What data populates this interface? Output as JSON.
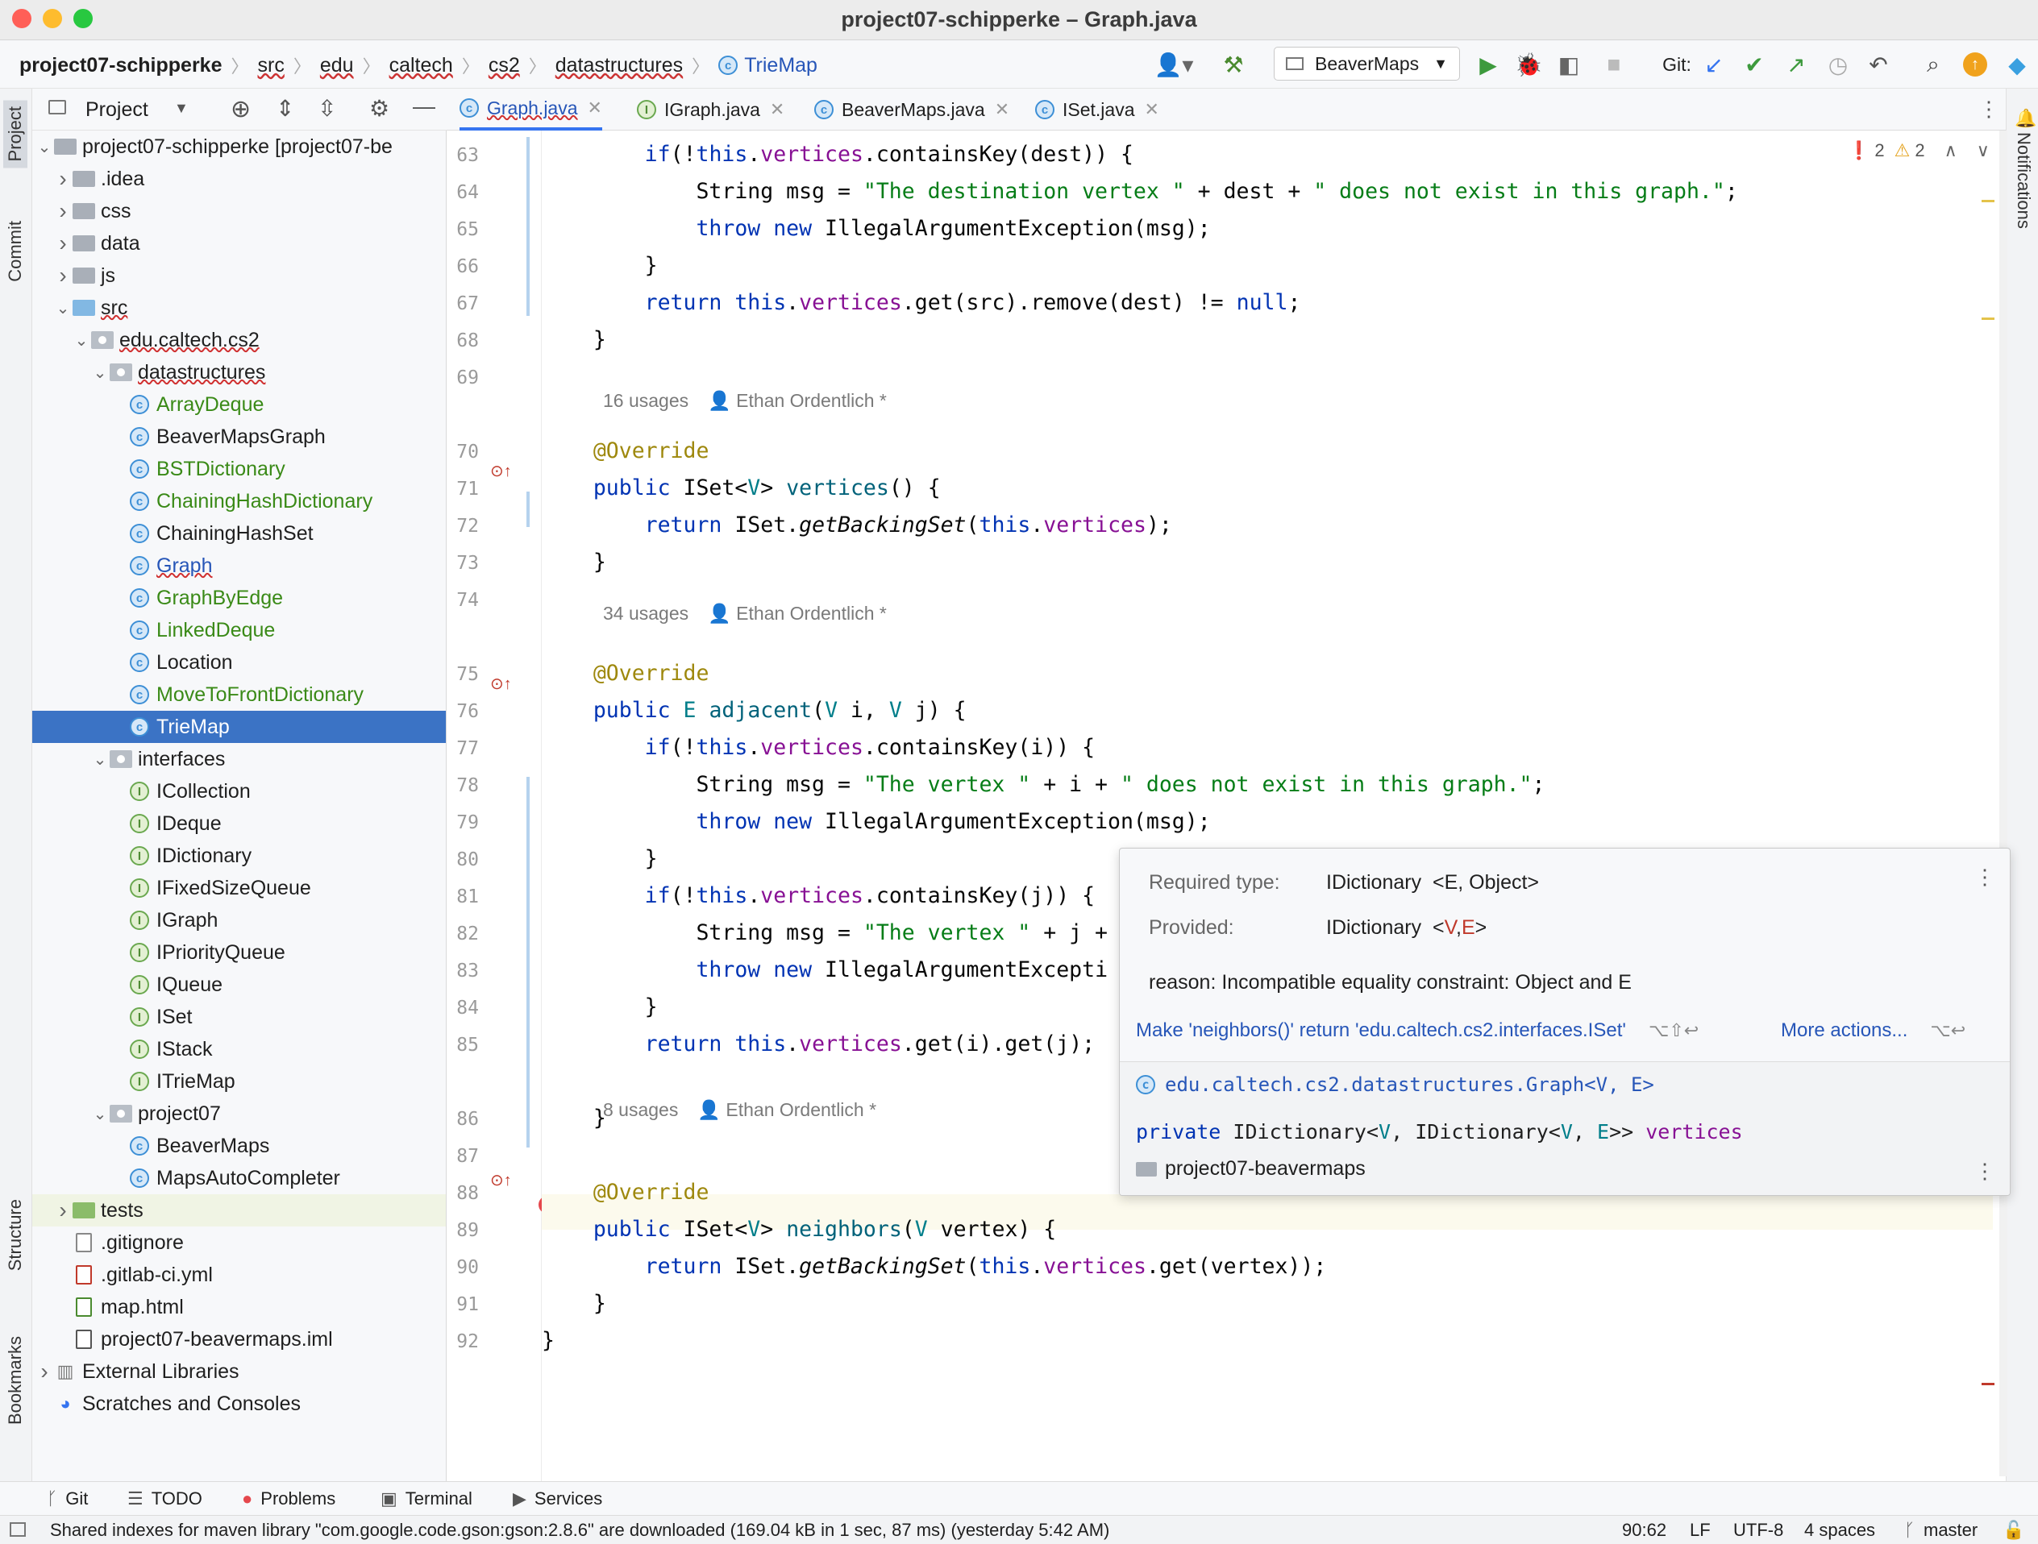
{
  "window": {
    "title": "project07-schipperke – Graph.java"
  },
  "breadcrumbs": [
    "project07-schipperke",
    "src",
    "edu",
    "caltech",
    "cs2",
    "datastructures",
    "TrieMap"
  ],
  "toolbar": {
    "run_config": "BeaverMaps",
    "git_label": "Git:"
  },
  "left_strip": {
    "project": "Project",
    "commit": "Commit",
    "structure": "Structure",
    "bookmarks": "Bookmarks"
  },
  "right_strip": {
    "notifications": "Notifications"
  },
  "project_panel": {
    "title": "Project",
    "tree": [
      {
        "label": "project07-schipperke [project07-be",
        "level": 0,
        "arrow": "open",
        "icon": "module-folder-icon"
      },
      {
        "label": ".idea",
        "level": 1,
        "arrow": "closed",
        "icon": "folder-icon"
      },
      {
        "label": "css",
        "level": 1,
        "arrow": "closed",
        "icon": "folder-icon"
      },
      {
        "label": "data",
        "level": 1,
        "arrow": "closed",
        "icon": "folder-icon"
      },
      {
        "label": "js",
        "level": 1,
        "arrow": "closed",
        "icon": "folder-icon"
      },
      {
        "label": "src",
        "level": 1,
        "arrow": "open",
        "icon": "source-folder-icon"
      },
      {
        "label": "edu.caltech.cs2",
        "level": 2,
        "arrow": "open",
        "icon": "package-icon"
      },
      {
        "label": "datastructures",
        "level": 3,
        "arrow": "open",
        "icon": "package-icon"
      },
      {
        "label": "ArrayDeque",
        "level": 4,
        "icon": "class-icon",
        "color": "green"
      },
      {
        "label": "BeaverMapsGraph",
        "level": 4,
        "icon": "class-icon"
      },
      {
        "label": "BSTDictionary",
        "level": 4,
        "icon": "class-icon",
        "color": "green"
      },
      {
        "label": "ChainingHashDictionary",
        "level": 4,
        "icon": "class-icon",
        "color": "green"
      },
      {
        "label": "ChainingHashSet",
        "level": 4,
        "icon": "class-icon"
      },
      {
        "label": "Graph",
        "level": 4,
        "icon": "class-icon",
        "color": "blue"
      },
      {
        "label": "GraphByEdge",
        "level": 4,
        "icon": "class-icon",
        "color": "green"
      },
      {
        "label": "LinkedDeque",
        "level": 4,
        "icon": "class-icon",
        "color": "green"
      },
      {
        "label": "Location",
        "level": 4,
        "icon": "class-icon"
      },
      {
        "label": "MoveToFrontDictionary",
        "level": 4,
        "icon": "class-icon",
        "color": "green"
      },
      {
        "label": "TrieMap",
        "level": 4,
        "icon": "class-icon",
        "selected": true
      },
      {
        "label": "interfaces",
        "level": 3,
        "arrow": "open",
        "icon": "package-icon"
      },
      {
        "label": "ICollection",
        "level": 4,
        "icon": "interface-icon"
      },
      {
        "label": "IDeque",
        "level": 4,
        "icon": "interface-icon"
      },
      {
        "label": "IDictionary",
        "level": 4,
        "icon": "interface-icon"
      },
      {
        "label": "IFixedSizeQueue",
        "level": 4,
        "icon": "interface-icon"
      },
      {
        "label": "IGraph",
        "level": 4,
        "icon": "interface-icon"
      },
      {
        "label": "IPriorityQueue",
        "level": 4,
        "icon": "interface-icon"
      },
      {
        "label": "IQueue",
        "level": 4,
        "icon": "interface-icon"
      },
      {
        "label": "ISet",
        "level": 4,
        "icon": "interface-icon"
      },
      {
        "label": "IStack",
        "level": 4,
        "icon": "interface-icon"
      },
      {
        "label": "ITrieMap",
        "level": 4,
        "icon": "interface-icon"
      },
      {
        "label": "project07",
        "level": 3,
        "arrow": "open",
        "icon": "package-icon"
      },
      {
        "label": "BeaverMaps",
        "level": 4,
        "icon": "class-icon"
      },
      {
        "label": "MapsAutoCompleter",
        "level": 4,
        "icon": "class-icon"
      },
      {
        "label": "tests",
        "level": 1,
        "arrow": "closed",
        "icon": "test-folder-icon",
        "highlight": true
      },
      {
        "label": ".gitignore",
        "level": 1,
        "icon": "file-icon"
      },
      {
        "label": ".gitlab-ci.yml",
        "level": 1,
        "icon": "yaml-file-icon"
      },
      {
        "label": "map.html",
        "level": 1,
        "icon": "html-file-icon"
      },
      {
        "label": "project07-beavermaps.iml",
        "level": 1,
        "icon": "iml-file-icon"
      },
      {
        "label": "External Libraries",
        "level": 0,
        "arrow": "closed",
        "icon": "library-icon"
      },
      {
        "label": "Scratches and Consoles",
        "level": 0,
        "icon": "scratches-icon"
      }
    ]
  },
  "tabs": [
    {
      "label": "Graph.java",
      "active": true,
      "icon": "class-icon"
    },
    {
      "label": "IGraph.java",
      "icon": "interface-icon"
    },
    {
      "label": "BeaverMaps.java",
      "icon": "class-icon"
    },
    {
      "label": "ISet.java",
      "icon": "class-icon"
    }
  ],
  "inspections": {
    "errors": "2",
    "warnings": "2"
  },
  "editor": {
    "usages": [
      {
        "count": "16 usages",
        "author": "Ethan Ordentlich *"
      },
      {
        "count": "34 usages",
        "author": "Ethan Ordentlich *"
      },
      {
        "count": "8 usages",
        "author": "Ethan Ordentlich *"
      }
    ],
    "lines": [
      {
        "n": "63",
        "text": "        if(!this.vertices.containsKey(dest)) {"
      },
      {
        "n": "64",
        "text": "            String msg = \"The destination vertex \" + dest + \" does not exist in this graph.\";"
      },
      {
        "n": "65",
        "text": "            throw new IllegalArgumentException(msg);"
      },
      {
        "n": "66",
        "text": "        }"
      },
      {
        "n": "67",
        "text": "        return this.vertices.get(src).remove(dest) != null;"
      },
      {
        "n": "68",
        "text": "    }"
      },
      {
        "n": "69",
        "text": ""
      },
      {
        "n": "70",
        "text": "    @Override"
      },
      {
        "n": "71",
        "text": "    public ISet<V> vertices() {"
      },
      {
        "n": "72",
        "text": "        return ISet.getBackingSet(this.vertices);"
      },
      {
        "n": "73",
        "text": "    }"
      },
      {
        "n": "74",
        "text": ""
      },
      {
        "n": "75",
        "text": "    @Override"
      },
      {
        "n": "76",
        "text": "    public E adjacent(V i, V j) {"
      },
      {
        "n": "77",
        "text": "        if(!this.vertices.containsKey(i)) {"
      },
      {
        "n": "78",
        "text": "            String msg = \"The vertex \" + i + \" does not exist in this graph.\";"
      },
      {
        "n": "79",
        "text": "            throw new IllegalArgumentException(msg);"
      },
      {
        "n": "80",
        "text": "        }"
      },
      {
        "n": "81",
        "text": "        if(!this.vertices.containsKey(j)) {"
      },
      {
        "n": "82",
        "text": "            String msg = \"The vertex \" + j +"
      },
      {
        "n": "83",
        "text": "            throw new IllegalArgumentExcepti"
      },
      {
        "n": "84",
        "text": "        }"
      },
      {
        "n": "85",
        "text": "        return this.vertices.get(i).get(j);"
      },
      {
        "n": "86",
        "text": "    }"
      },
      {
        "n": "87",
        "text": ""
      },
      {
        "n": "88",
        "text": "    @Override"
      },
      {
        "n": "89",
        "text": "    public ISet<V> neighbors(V vertex) {"
      },
      {
        "n": "90",
        "text": "        return ISet.getBackingSet(this.vertices.get(vertex));"
      },
      {
        "n": "91",
        "text": "    }"
      },
      {
        "n": "92",
        "text": "}"
      }
    ]
  },
  "popup": {
    "required_label": "Required type:",
    "required_value": "IDictionary",
    "required_generic": "<E, Object>",
    "provided_label": "Provided:",
    "provided_value": "IDictionary",
    "provided_open": "<",
    "provided_v": "V",
    "provided_comma": ",",
    "provided_e": "E",
    "provided_close": ">",
    "reason": "reason: Incompatible equality constraint: Object and E",
    "fix_action": "Make 'neighbors()' return 'edu.caltech.cs2.interfaces.ISet'",
    "fix_shortcut": "⌥⇧↩",
    "more_actions": "More actions...",
    "more_shortcut": "⌥↩",
    "class_ref": "edu.caltech.cs2.datastructures.Graph<V, E>",
    "decl_private": "private",
    "decl_type_a": "IDictionary<",
    "decl_v1": "V",
    "decl_type_b": ", IDictionary<",
    "decl_v2": "V",
    "decl_sep": ", ",
    "decl_e": "E",
    "decl_close": ">>",
    "decl_field": "vertices",
    "module": "project07-beavermaps"
  },
  "bottom_tools": [
    {
      "label": "Git",
      "icon": "git-branch-icon"
    },
    {
      "label": "TODO",
      "icon": "list-icon"
    },
    {
      "label": "Problems",
      "icon": "error-icon"
    },
    {
      "label": "Terminal",
      "icon": "terminal-icon"
    },
    {
      "label": "Services",
      "icon": "services-icon"
    }
  ],
  "status": {
    "message": "Shared indexes for maven library \"com.google.code.gson:gson:2.8.6\" are downloaded (169.04 kB in 1 sec, 87 ms) (yesterday 5:42 AM)",
    "position": "90:62",
    "line_sep": "LF",
    "encoding": "UTF-8",
    "indent": "4 spaces",
    "branch": "master"
  },
  "colors": {
    "selection": "#3b73c5",
    "keyword": "#0033b3",
    "string": "#067d17",
    "field": "#871094",
    "annotation": "#9e880d",
    "error": "#e5484d"
  }
}
